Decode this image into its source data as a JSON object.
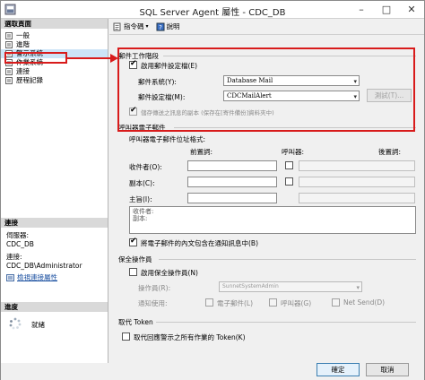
{
  "window": {
    "title": "SQL Server Agent 屬性 - CDC_DB"
  },
  "left": {
    "select_page_header": "選取頁面",
    "pages": [
      {
        "label": "一般"
      },
      {
        "label": "進階"
      },
      {
        "label": "警示系統"
      },
      {
        "label": "作業系統"
      },
      {
        "label": "連接"
      },
      {
        "label": "歷程記錄"
      }
    ],
    "connection_header": "連接",
    "server_label": "伺服器:",
    "server_value": "CDC_DB",
    "conn_label": "連接:",
    "conn_value": "CDC_DB\\Administrator",
    "view_conn_link": "檢視連接屬性",
    "progress_header": "進度",
    "progress_status": "就緒"
  },
  "toolbar": {
    "script_label": "指令碼",
    "help_label": "說明"
  },
  "mail": {
    "section_label": "郵件工作階段",
    "enable_label": "啟用郵件設定檔(E)",
    "enable_checked": true,
    "mail_system_label": "郵件系統(Y):",
    "mail_system_value": "Database Mail",
    "profile_label": "郵件設定檔(M):",
    "profile_value": "CDCMailAlert",
    "test_button": "測試(T)...",
    "save_copies_label": "儲存傳送之訊息的副本 (保存在[寄件備份]資料夾中)"
  },
  "pager": {
    "section_label": "呼叫器電子郵件",
    "format_label": "呼叫器電子郵件位址格式:",
    "col_prefix": "前置詞:",
    "col_pager": "呼叫器:",
    "col_suffix": "後置詞:",
    "to_label": "收件者(O):",
    "cc_label": "副本(C):",
    "subject_label": "主旨(I):",
    "preview_line1": "收件者:",
    "preview_line2": "副本:",
    "include_body_label": "將電子郵件的內文包含在通知訊息中(B)",
    "include_body_checked": true
  },
  "failsafe": {
    "section_label": "保全操作員",
    "enable_label": "啟用保全操作員(N)",
    "operator_label": "操作員(R):",
    "operator_value": "SunnetSystemAdmin",
    "notify_label": "通知使用:",
    "email_label": "電子郵件(L)",
    "pager_label": "呼叫器(G)",
    "netsend_label": "Net Send(D)"
  },
  "token": {
    "section_label": "取代 Token",
    "replace_label": "取代回應警示之所有作業的 Token(K)"
  },
  "footer": {
    "ok_button": "確定",
    "cancel_button": "取消"
  }
}
